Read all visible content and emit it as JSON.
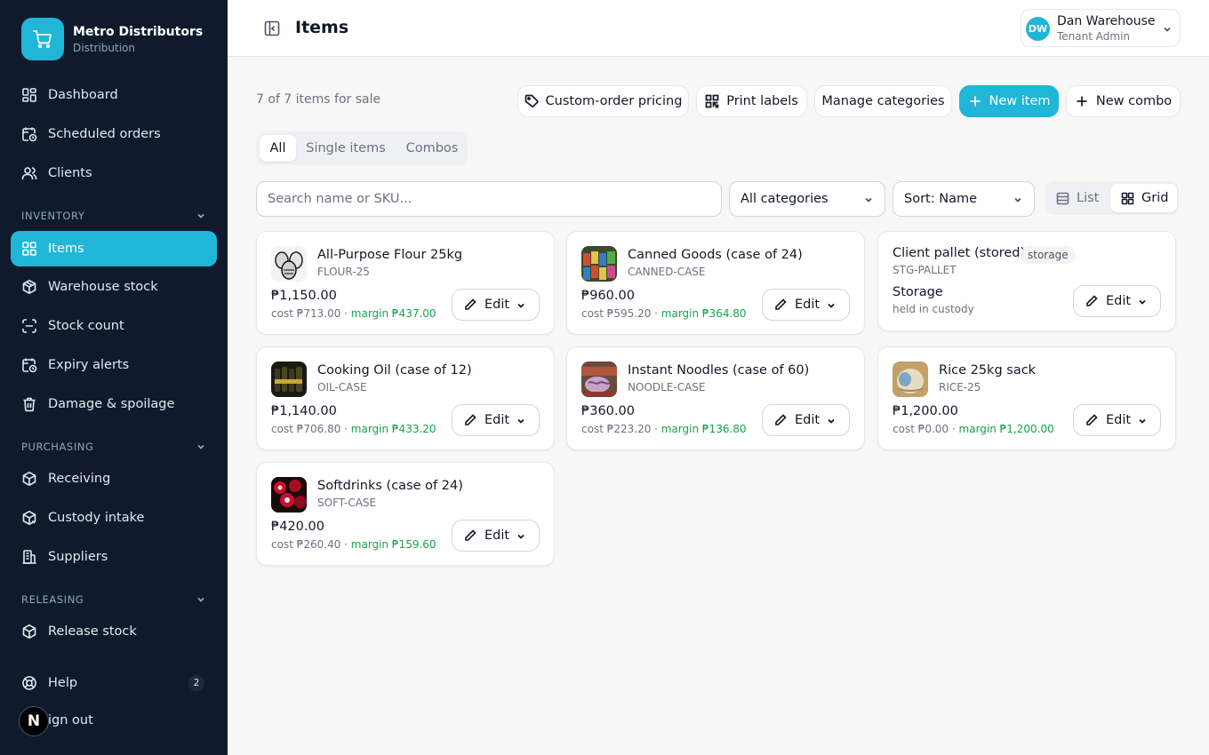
{
  "brand": {
    "name": "Metro Distributors",
    "subtitle": "Distribution",
    "icon": "shopping-cart-icon"
  },
  "sidebar": {
    "top_items": [
      {
        "label": "Dashboard",
        "icon": "dashboard-icon"
      },
      {
        "label": "Scheduled orders",
        "icon": "calendar-clock-icon"
      },
      {
        "label": "Clients",
        "icon": "users-icon"
      }
    ],
    "sections": [
      {
        "title": "INVENTORY",
        "items": [
          {
            "label": "Items",
            "icon": "grid-icon",
            "active": true
          },
          {
            "label": "Warehouse stock",
            "icon": "box-icon"
          },
          {
            "label": "Stock count",
            "icon": "scan-icon"
          },
          {
            "label": "Expiry alerts",
            "icon": "calendar-clock-icon"
          },
          {
            "label": "Damage & spoilage",
            "icon": "trash-icon"
          }
        ]
      },
      {
        "title": "PURCHASING",
        "items": [
          {
            "label": "Receiving",
            "icon": "box-icon"
          },
          {
            "label": "Custody intake",
            "icon": "box-icon"
          },
          {
            "label": "Suppliers",
            "icon": "building-icon"
          }
        ]
      },
      {
        "title": "RELEASING",
        "items": [
          {
            "label": "Release stock",
            "icon": "box-icon"
          }
        ]
      }
    ],
    "help": {
      "label": "Help",
      "badge": "2",
      "icon": "lifebuoy-icon"
    },
    "signout": {
      "label": "Sign out",
      "visible_label": "ign out"
    },
    "dev_badge": "N"
  },
  "header": {
    "title": "Items",
    "user": {
      "initials": "DW",
      "name": "Dan Warehouse",
      "role": "Tenant Admin"
    }
  },
  "toolbar": {
    "count_text": "7 of 7 items for sale",
    "custom_pricing": "Custom-order pricing",
    "print_labels": "Print labels",
    "manage_categories": "Manage categories",
    "new_item": "New item",
    "new_combo": "New combo"
  },
  "tabs": [
    "All",
    "Single items",
    "Combos"
  ],
  "filters": {
    "search_placeholder": "Search name or SKU...",
    "category": "All categories",
    "sort": "Sort: Name",
    "view_list": "List",
    "view_grid": "Grid"
  },
  "colors": {
    "accent": "#1fb6d8",
    "sidebar_bg": "#0f1b2d",
    "margin_green": "#16a34a"
  },
  "items": [
    {
      "name": "All-Purpose Flour 25kg",
      "sku": "FLOUR-25",
      "price": "₱1,150.00",
      "cost": "cost ₱713.00 · ",
      "margin": "margin ₱437.00",
      "edit": "Edit",
      "thumb": "flour-sacks-image"
    },
    {
      "name": "Canned Goods (case of 24)",
      "sku": "CANNED-CASE",
      "price": "₱960.00",
      "cost": "cost ₱595.20 · ",
      "margin": "margin ₱364.80",
      "edit": "Edit",
      "thumb": "canned-goods-image"
    },
    {
      "name": "Client pallet (stored)",
      "badge": "storage",
      "sku": "STG-PALLET",
      "type": "Storage",
      "note": "held in custody",
      "edit": "Edit"
    },
    {
      "name": "Cooking Oil (case of 12)",
      "sku": "OIL-CASE",
      "price": "₱1,140.00",
      "cost": "cost ₱706.80 · ",
      "margin": "margin ₱433.20",
      "edit": "Edit",
      "thumb": "oil-bottles-image"
    },
    {
      "name": "Instant Noodles (case of 60)",
      "sku": "NOODLE-CASE",
      "price": "₱360.00",
      "cost": "cost ₱223.20 · ",
      "margin": "margin ₱136.80",
      "edit": "Edit",
      "thumb": "noodles-image"
    },
    {
      "name": "Rice 25kg sack",
      "sku": "RICE-25",
      "price": "₱1,200.00",
      "cost": "cost ₱0.00 · ",
      "margin": "margin ₱1,200.00",
      "edit": "Edit",
      "thumb": "rice-sack-image"
    },
    {
      "name": "Softdrinks (case of 24)",
      "sku": "SOFT-CASE",
      "price": "₱420.00",
      "cost": "cost ₱260.40 · ",
      "margin": "margin ₱159.60",
      "edit": "Edit",
      "thumb": "softdrinks-image"
    }
  ]
}
